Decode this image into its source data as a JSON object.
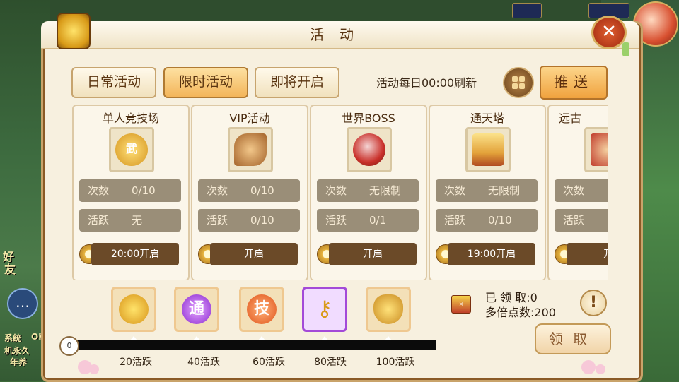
{
  "window": {
    "title": "活动"
  },
  "tabs": [
    {
      "label": "日常活动",
      "active": false
    },
    {
      "label": "限时活动",
      "active": true
    },
    {
      "label": "即将开启",
      "active": false
    }
  ],
  "header": {
    "refresh_text": "活动每日00:00刷新",
    "push_label": "推送"
  },
  "activities": [
    {
      "name": "单人竞技场",
      "icon": "warrior-medal-icon",
      "count_label": "次数",
      "count_value": "0/10",
      "active_label": "活跃",
      "active_value": "无",
      "open_text": "20:00开启"
    },
    {
      "name": "VIP活动",
      "icon": "horn-icon",
      "count_label": "次数",
      "count_value": "0/10",
      "active_label": "活跃",
      "active_value": "0/10",
      "open_text": "开启"
    },
    {
      "name": "世界BOSS",
      "icon": "boss-orb-icon",
      "count_label": "次数",
      "count_value": "无限制",
      "active_label": "活跃",
      "active_value": "0/1",
      "open_text": "开启"
    },
    {
      "name": "通天塔",
      "icon": "tower-icon",
      "count_label": "次数",
      "count_value": "无限制",
      "active_label": "活跃",
      "active_value": "0/10",
      "open_text": "19:00开启"
    },
    {
      "name": "远古",
      "icon": "ancient-hero-icon",
      "count_label": "次数",
      "count_value": "",
      "active_label": "活跃",
      "active_value": "",
      "open_text": "开"
    }
  ],
  "rewards": [
    {
      "threshold": "20活跃",
      "icon": "gold-coin-icon",
      "glyph": ""
    },
    {
      "threshold": "40活跃",
      "icon": "tong-token-icon",
      "glyph": "通"
    },
    {
      "threshold": "60活跃",
      "icon": "skill-token-icon",
      "glyph": "技"
    },
    {
      "threshold": "80活跃",
      "icon": "key-icon",
      "glyph": ""
    },
    {
      "threshold": "100活跃",
      "icon": "treasure-bag-icon",
      "glyph": ""
    }
  ],
  "progress": {
    "start_value": "0",
    "fraction": 0.0
  },
  "claim": {
    "received_label": "已 领 取:0",
    "multiplier_label": "多倍点数:200",
    "claim_button": "领取",
    "info_glyph": "!"
  },
  "side": {
    "left_tags": [
      "好",
      "友",
      "系统",
      "OK",
      "机永久",
      "年养"
    ]
  },
  "colors": {
    "accent": "#f0a23e",
    "panel_bg": "#f7f0df",
    "text_dark": "#5a3410"
  }
}
